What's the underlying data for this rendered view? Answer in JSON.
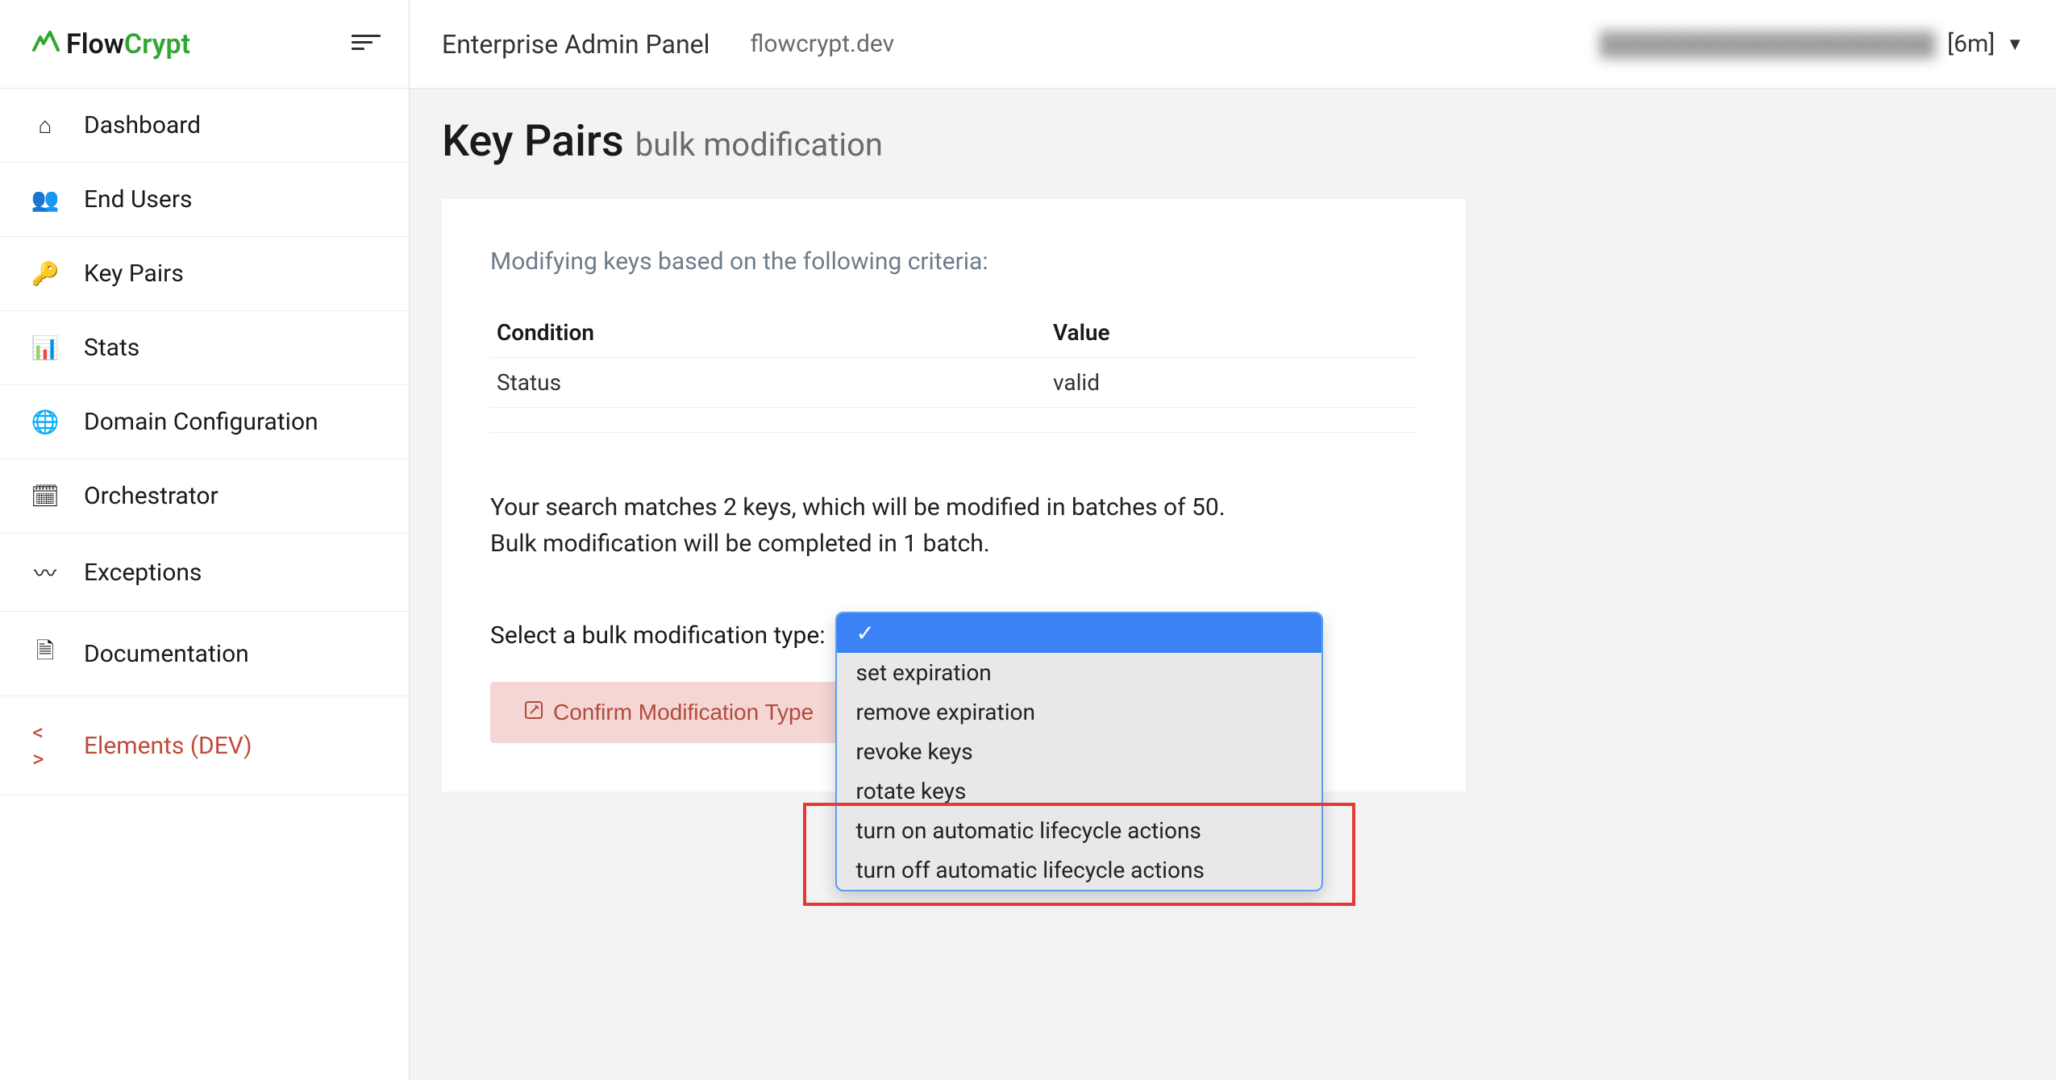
{
  "logo": {
    "flow": "Flow",
    "crypt": "Crypt"
  },
  "sidebar": {
    "items": [
      {
        "label": "Dashboard",
        "icon": "home-icon",
        "glyph": "⌂"
      },
      {
        "label": "End Users",
        "icon": "users-icon",
        "glyph": "👥"
      },
      {
        "label": "Key Pairs",
        "icon": "key-icon",
        "glyph": "🔑"
      },
      {
        "label": "Stats",
        "icon": "stats-icon",
        "glyph": "📊"
      },
      {
        "label": "Domain Configuration",
        "icon": "globe-icon",
        "glyph": "🌐"
      },
      {
        "label": "Orchestrator",
        "icon": "calendar-icon",
        "glyph": "🗓"
      },
      {
        "label": "Exceptions",
        "icon": "exceptions-icon",
        "glyph": "〰"
      },
      {
        "label": "Documentation",
        "icon": "document-icon",
        "glyph": "🗎"
      },
      {
        "label": "Elements (DEV)",
        "icon": "code-icon",
        "glyph": "< >",
        "dev": true
      }
    ]
  },
  "topbar": {
    "title": "Enterprise Admin Panel",
    "domain": "flowcrypt.dev",
    "session": "[6m]"
  },
  "page": {
    "title": "Key Pairs",
    "subtitle": "bulk modification"
  },
  "criteria": {
    "intro": "Modifying keys based on the following criteria:",
    "headers": {
      "condition": "Condition",
      "value": "Value"
    },
    "rows": [
      {
        "condition": "Status",
        "value": "valid"
      }
    ]
  },
  "summary": {
    "line1": "Your search matches 2 keys, which will be modified in batches of 50.",
    "line2": "Bulk modification will be completed in 1 batch."
  },
  "select": {
    "label": "Select a bulk modification type:",
    "options": [
      {
        "label": "✓",
        "selected": true
      },
      {
        "label": "set expiration"
      },
      {
        "label": "remove expiration"
      },
      {
        "label": "revoke keys"
      },
      {
        "label": "rotate keys"
      },
      {
        "label": "turn on automatic lifecycle actions"
      },
      {
        "label": "turn off automatic lifecycle actions"
      }
    ]
  },
  "confirm": {
    "label": "Confirm Modification Type"
  }
}
